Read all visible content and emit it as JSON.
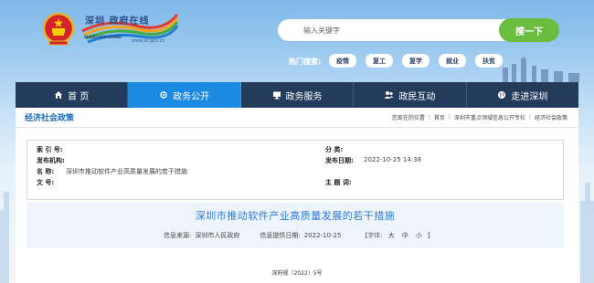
{
  "header": {
    "logo_title": "深圳 政府在线",
    "logo_en": "SHENZHEN·CHINA",
    "logo_url": "www.sz.gov.cn"
  },
  "search": {
    "placeholder": "输入关键字",
    "button_label": "搜一下",
    "hot_label": "热门搜索:",
    "hot_tags": [
      "疫情",
      "复工",
      "复学",
      "就业",
      "扶贫"
    ]
  },
  "nav": {
    "items": [
      {
        "label": "首 页",
        "icon": "home-icon"
      },
      {
        "label": "政务公开",
        "icon": "gear-icon"
      },
      {
        "label": "政务服务",
        "icon": "monitor-icon"
      },
      {
        "label": "政民互动",
        "icon": "people-icon"
      },
      {
        "label": "走进深圳",
        "icon": "globe-icon"
      }
    ],
    "active_index": 1
  },
  "crumbbar": {
    "section_title": "经济社会政策",
    "location_label": "您现在的位置",
    "crumbs": [
      "首页",
      "深圳市重点领域信息公开专栏",
      "经济社会政策"
    ]
  },
  "meta": {
    "index_no_label": "索 引 号:",
    "index_no": "",
    "issuer_label": "发布机构:",
    "issuer": "",
    "name_label": "名 称:",
    "name": "深圳市推动软件产业高质量发展的若干措施",
    "doc_no_label": "文 号:",
    "doc_no": "",
    "category_label": "分 类:",
    "category": "",
    "publish_date_label": "发布日期:",
    "publish_date": "2022-10-25 14:38",
    "keywords_label": "主 题 词:",
    "keywords": ""
  },
  "article": {
    "title": "深圳市推动软件产业高质量发展的若干措施",
    "source_label": "信息来源:",
    "source": "深圳市人民政府",
    "provided_date_label": "信息提供日期:",
    "provided_date": "2022-10-25",
    "font_label": "【字体:",
    "font_large": "大",
    "font_medium": "中",
    "font_small": "小",
    "font_close": "】",
    "doc_number": "深府规〔2022〕5号"
  },
  "colors": {
    "nav_bg": "#243c5c",
    "nav_active": "#1c8ae0",
    "search_button": "#6bbd3f",
    "title_blue": "#2d7ad6"
  }
}
